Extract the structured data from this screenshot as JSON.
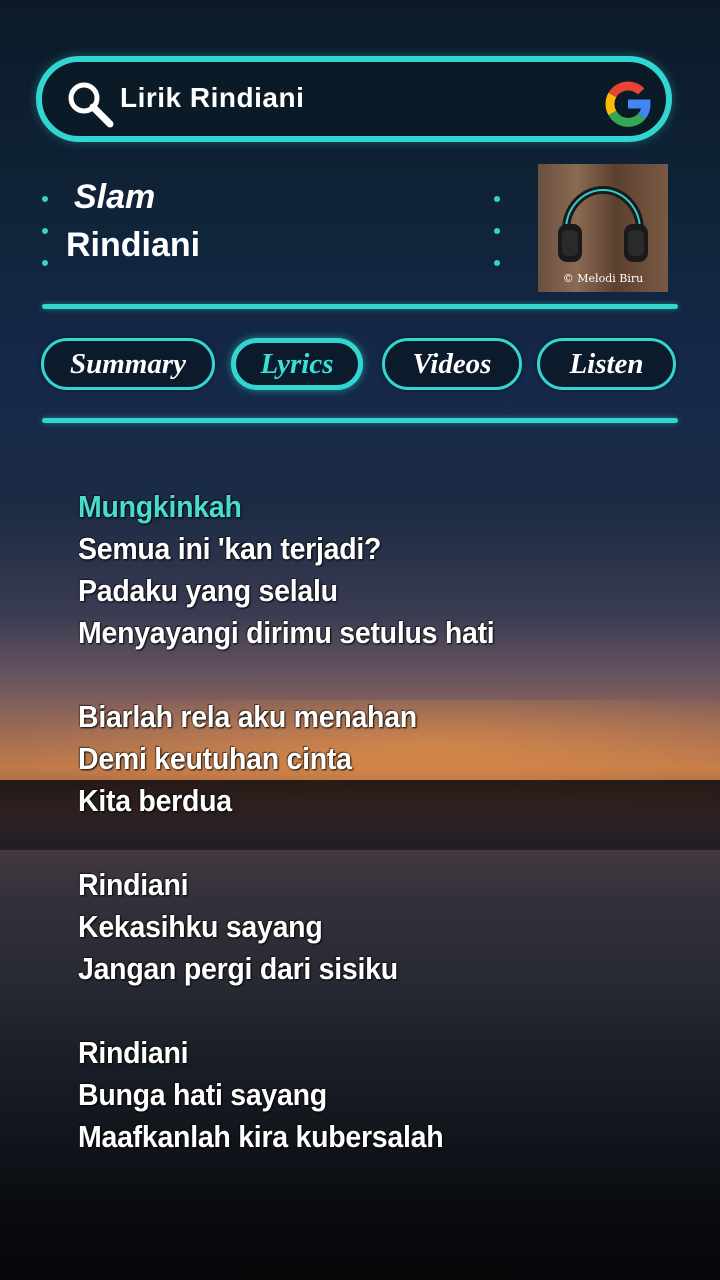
{
  "search": {
    "query": "Lirik Rindiani"
  },
  "song": {
    "title": "Slam",
    "artist": "Rindiani"
  },
  "thumbnail": {
    "caption": "© Melodi Biru"
  },
  "tabs": [
    {
      "label": "Summary",
      "active": false
    },
    {
      "label": "Lyrics",
      "active": true
    },
    {
      "label": "Videos",
      "active": false
    },
    {
      "label": "Listen",
      "active": false
    }
  ],
  "lyrics": {
    "stanzas": [
      [
        "Mungkinkah",
        "Semua ini 'kan terjadi?",
        "Padaku yang selalu",
        "Menyayangi dirimu setulus hati"
      ],
      [
        "Biarlah rela aku menahan",
        "Demi keutuhan cinta",
        "Kita berdua"
      ],
      [
        "Rindiani",
        "Kekasihku sayang",
        "Jangan pergi dari sisiku"
      ],
      [
        "Rindiani",
        "Bunga hati sayang",
        "Maafkanlah kira kubersalah"
      ]
    ]
  },
  "colors": {
    "accent": "#32d6d0",
    "highlight_lyric": "#49dccc"
  }
}
